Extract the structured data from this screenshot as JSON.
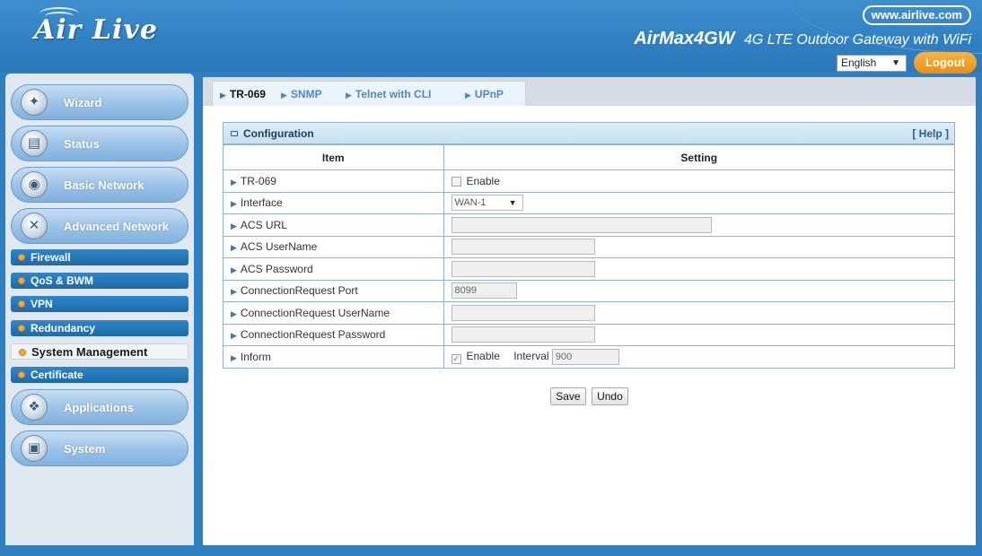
{
  "header": {
    "logo": "Air Live",
    "website": "www.airlive.com",
    "product_name": "AirMax4GW",
    "product_desc": "4G LTE Outdoor Gateway with WiFi",
    "language": "English",
    "logout_label": "Logout"
  },
  "sidebar": {
    "main_items": [
      {
        "label": "Wizard",
        "icon": "wizard-icon"
      },
      {
        "label": "Status",
        "icon": "status-icon"
      },
      {
        "label": "Basic Network",
        "icon": "basic-network-icon"
      },
      {
        "label": "Advanced Network",
        "icon": "advanced-network-icon"
      }
    ],
    "sub_items": [
      {
        "label": "Firewall"
      },
      {
        "label": "QoS & BWM"
      },
      {
        "label": "VPN"
      },
      {
        "label": "Redundancy"
      },
      {
        "label": "System Management",
        "active": true
      },
      {
        "label": "Certificate"
      }
    ],
    "lower_items": [
      {
        "label": "Applications",
        "icon": "applications-icon"
      },
      {
        "label": "System",
        "icon": "system-icon"
      }
    ]
  },
  "tabs": [
    {
      "label": "TR-069",
      "active": true
    },
    {
      "label": "SNMP"
    },
    {
      "label": "Telnet with CLI"
    },
    {
      "label": "UPnP"
    }
  ],
  "config": {
    "title": "Configuration",
    "help": "[ Help ]",
    "col_item": "Item",
    "col_setting": "Setting",
    "rows": {
      "tr069": {
        "label": "TR-069",
        "checkbox_label": "Enable",
        "checked": false
      },
      "interface": {
        "label": "Interface",
        "value": "WAN-1"
      },
      "acs_url": {
        "label": "ACS URL",
        "value": ""
      },
      "acs_username": {
        "label": "ACS UserName",
        "value": ""
      },
      "acs_password": {
        "label": "ACS Password",
        "value": ""
      },
      "conn_port": {
        "label": "ConnectionRequest Port",
        "value": "8099"
      },
      "conn_username": {
        "label": "ConnectionRequest UserName",
        "value": ""
      },
      "conn_password": {
        "label": "ConnectionRequest Password",
        "value": ""
      },
      "inform": {
        "label": "Inform",
        "checkbox_label": "Enable",
        "checked": true,
        "interval_label": "Interval",
        "interval_value": "900"
      }
    }
  },
  "actions": {
    "save": "Save",
    "undo": "Undo"
  },
  "colors": {
    "header_blue": "#2e7fc1",
    "logout_orange": "#ec8f12",
    "submenu_blue": "#1d6aab"
  }
}
